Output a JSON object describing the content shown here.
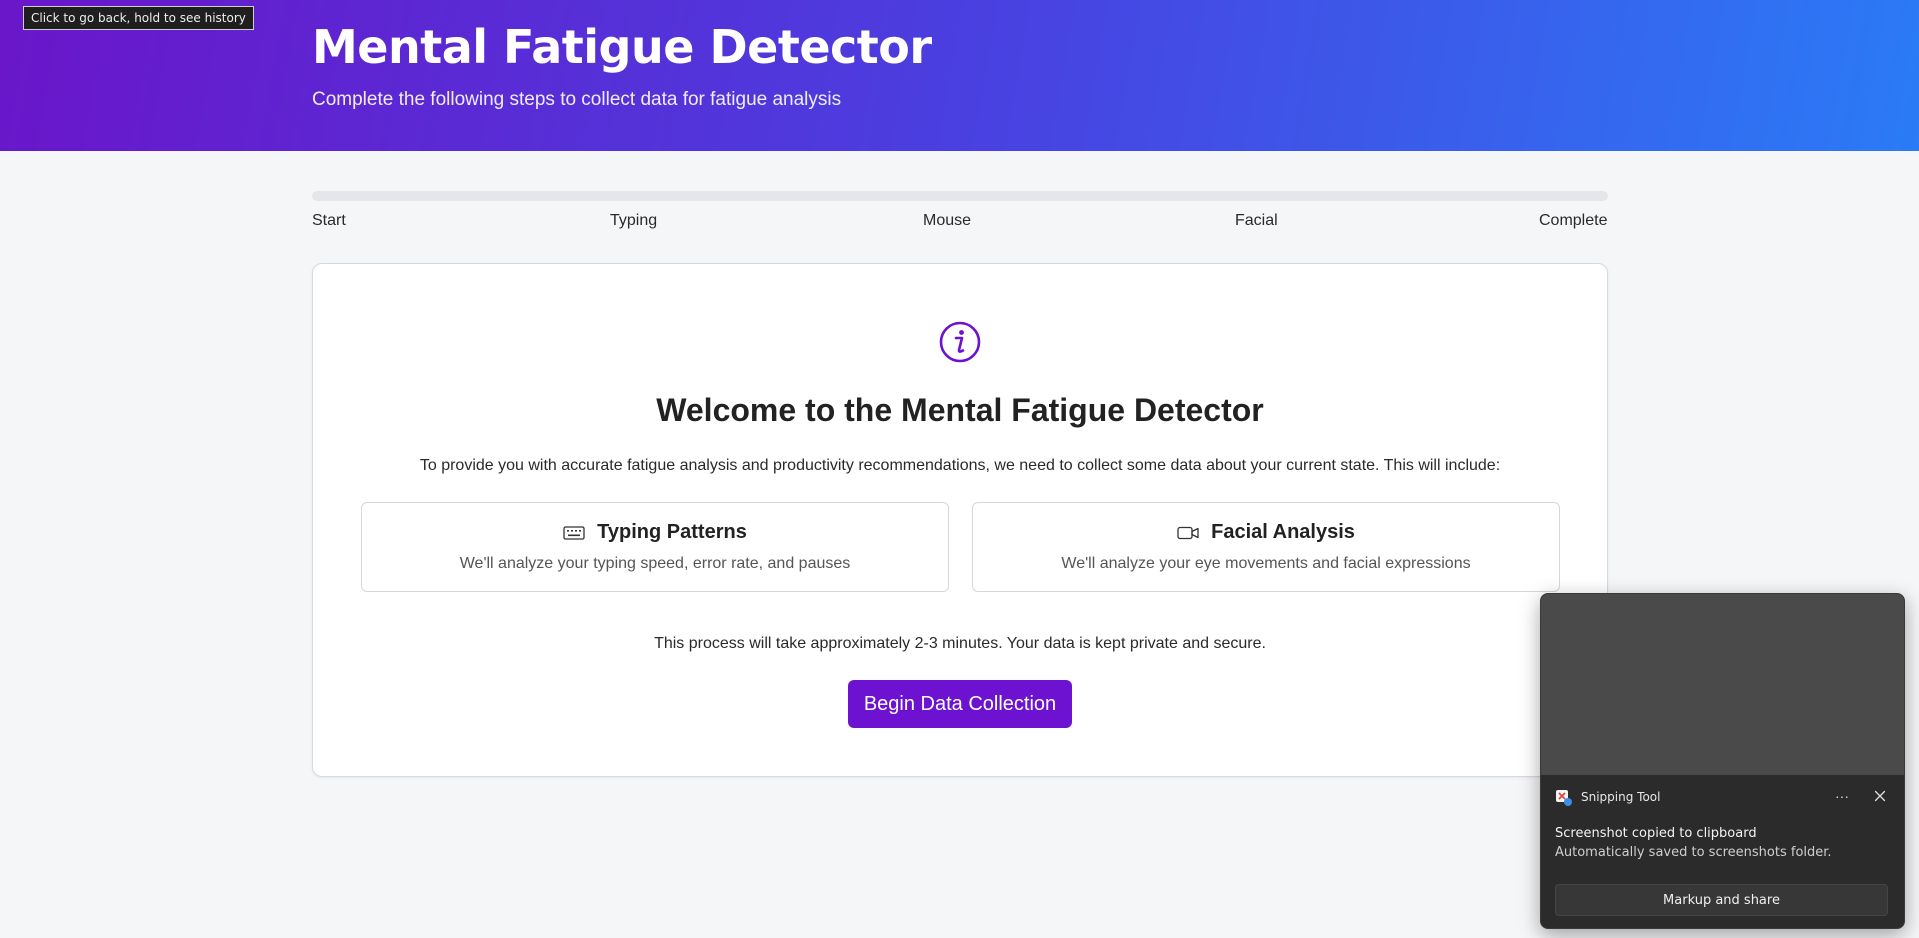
{
  "browser": {
    "back_tooltip": "Click to go back, hold to see history"
  },
  "header": {
    "title": "Mental Fatigue Detector",
    "subtitle": "Complete the following steps to collect data for fatigue analysis"
  },
  "progress": {
    "fraction": 0,
    "steps": [
      "Start",
      "Typing",
      "Mouse",
      "Facial",
      "Complete"
    ]
  },
  "welcome": {
    "icon": "info-icon",
    "title": "Welcome to the Mental Fatigue Detector",
    "intro": "To provide you with accurate fatigue analysis and productivity recommendations, we need to collect some data about your current state. This will include:",
    "features": [
      {
        "icon": "keyboard-icon",
        "title": "Typing Patterns",
        "description": "We'll analyze your typing speed, error rate, and pauses"
      },
      {
        "icon": "video-camera-icon",
        "title": "Facial Analysis",
        "description": "We'll analyze your eye movements and facial expressions"
      }
    ],
    "process_note": "This process will take approximately 2-3 minutes. Your data is kept private and secure.",
    "begin_label": "Begin Data Collection"
  },
  "toast": {
    "app_name": "Snipping Tool",
    "more_label": "···",
    "message": "Screenshot copied to clipboard",
    "detail": "Automatically saved to screenshots folder.",
    "action_label": "Markup and share"
  },
  "colors": {
    "accent": "#6c12d0",
    "header_start": "#6a16c9",
    "header_end": "#2a7bf6"
  }
}
